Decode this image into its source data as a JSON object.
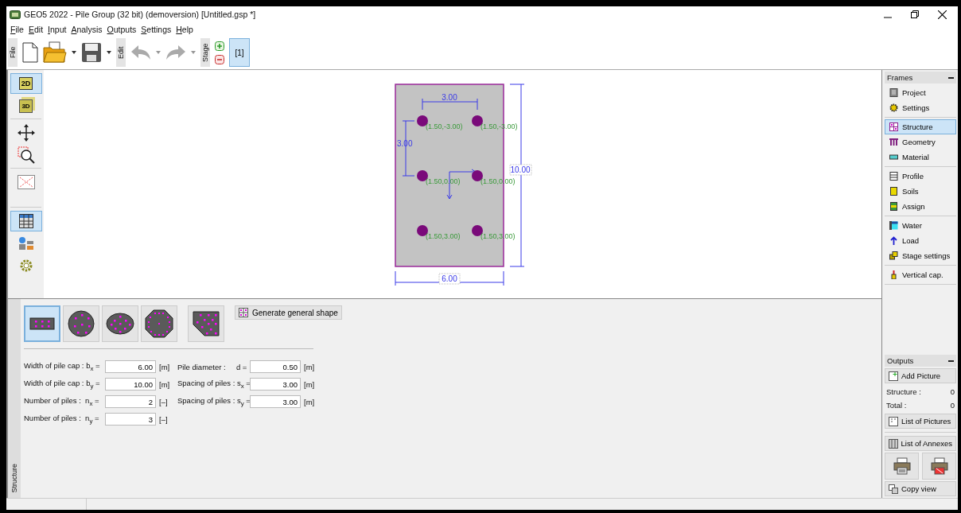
{
  "window": {
    "title": "GEO5 2022 - Pile Group (32 bit) (demoversion) [Untitled.gsp *]"
  },
  "menu": [
    "File",
    "Edit",
    "Input",
    "Analysis",
    "Outputs",
    "Settings",
    "Help"
  ],
  "toolbar": {
    "file_label": "File",
    "edit_label": "Edit",
    "stage_label": "Stage",
    "stages": [
      {
        "label": "[1]",
        "selected": true
      }
    ]
  },
  "view_tools": [
    {
      "items": [
        {
          "kind": "view2d",
          "label": "2D",
          "selected": true
        },
        {
          "kind": "view3d",
          "label": "3D",
          "selected": false
        }
      ]
    },
    {
      "items": [
        {
          "kind": "pan",
          "selected": false
        },
        {
          "kind": "zoom",
          "selected": false
        }
      ]
    },
    {
      "items": [
        {
          "kind": "fit",
          "selected": false
        }
      ]
    },
    {
      "items": [
        {
          "kind": "table",
          "selected": true
        },
        {
          "kind": "layers",
          "selected": false
        },
        {
          "kind": "settings",
          "selected": false
        }
      ]
    }
  ],
  "drawing": {
    "width_label": "6.00",
    "height_label": "10.00",
    "spacing_x_label": "3.00",
    "spacing_y_label": "3.00",
    "piles": [
      {
        "label": "(1.50,-3.00)"
      },
      {
        "label": "(1.50,-3.00)"
      },
      {
        "label": "(1.50,0.00)"
      },
      {
        "label": "(1.50,0.00)"
      },
      {
        "label": "(1.50,3.00)"
      },
      {
        "label": "(1.50,3.00)"
      }
    ]
  },
  "frames": {
    "title": "Frames",
    "groups": [
      {
        "items": [
          {
            "kind": "project",
            "label": "Project",
            "selected": false
          },
          {
            "kind": "settings",
            "label": "Settings",
            "selected": false
          }
        ]
      },
      {
        "items": [
          {
            "kind": "structure",
            "label": "Structure",
            "selected": true
          },
          {
            "kind": "geometry",
            "label": "Geometry",
            "selected": false
          },
          {
            "kind": "material",
            "label": "Material",
            "selected": false
          }
        ]
      },
      {
        "items": [
          {
            "kind": "profile",
            "label": "Profile",
            "selected": false
          },
          {
            "kind": "soils",
            "label": "Soils",
            "selected": false
          },
          {
            "kind": "assign",
            "label": "Assign",
            "selected": false
          }
        ]
      },
      {
        "items": [
          {
            "kind": "water",
            "label": "Water",
            "selected": false
          },
          {
            "kind": "load",
            "label": "Load",
            "selected": false
          },
          {
            "kind": "stage",
            "label": "Stage settings",
            "selected": false
          }
        ]
      },
      {
        "items": [
          {
            "kind": "vertical",
            "label": "Vertical cap.",
            "selected": false
          }
        ]
      }
    ]
  },
  "side_tab": "Structure",
  "shapes": [
    {
      "kind": "rectangle",
      "selected": true
    },
    {
      "kind": "circle",
      "selected": false
    },
    {
      "kind": "ellipse",
      "selected": false
    },
    {
      "kind": "octagon",
      "selected": false
    },
    {
      "kind": "general",
      "selected": false
    }
  ],
  "generate_button": "Generate general shape",
  "fields": [
    [
      {
        "label": "Width of pile cap : b$_{x}$ =",
        "value": "6.00",
        "unit": "[m]"
      },
      {
        "label": "Pile diameter :     d =",
        "value": "0.50",
        "unit": "[m]"
      }
    ],
    [
      {
        "label": "Width of pile cap : b$_{y}$ =",
        "value": "10.00",
        "unit": "[m]"
      },
      {
        "label": "Spacing of piles : s$_{x}$ =",
        "value": "3.00",
        "unit": "[m]"
      }
    ],
    [
      {
        "label": "Number of piles :  n$_{x}$ =",
        "value": "2",
        "unit": "[–]"
      },
      {
        "label": "Spacing of piles : s$_{y}$ =",
        "value": "3.00",
        "unit": "[m]"
      }
    ],
    [
      {
        "label": "Number of piles :  n$_{y}$ =",
        "value": "3",
        "unit": "[–]"
      }
    ]
  ],
  "outputs": {
    "title": "Outputs",
    "add_picture": "Add Picture",
    "counts": [
      {
        "label": "Structure :",
        "value": "0"
      },
      {
        "label": "Total :",
        "value": "0"
      }
    ],
    "list_pictures": "List of Pictures",
    "list_annexes": "List of Annexes",
    "copy_view": "Copy view"
  }
}
